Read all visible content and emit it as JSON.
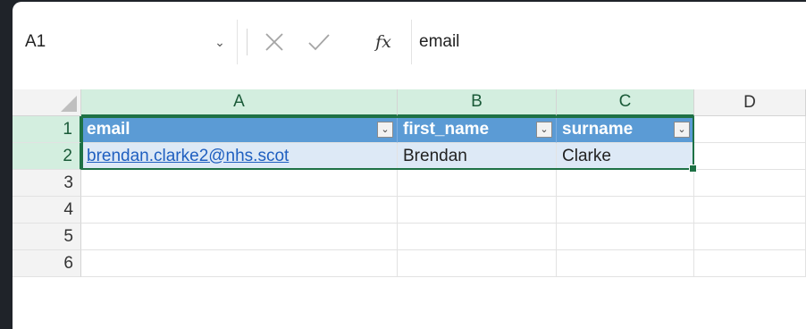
{
  "formula_bar": {
    "name_box": "A1",
    "cancel_icon": "close-icon",
    "enter_icon": "check-icon",
    "fx_label": "fx",
    "formula": "email"
  },
  "grid": {
    "columns": [
      "A",
      "B",
      "C",
      "D"
    ],
    "rows": [
      "1",
      "2",
      "3",
      "4",
      "5",
      "6"
    ],
    "table": {
      "headers": [
        "email",
        "first_name",
        "surname"
      ],
      "rows": [
        [
          "brendan.clarke2@nhs.scot",
          "Brendan",
          "Clarke"
        ]
      ]
    }
  },
  "colors": {
    "table_header": "#5b9bd5",
    "table_band": "#dde9f6",
    "selection": "#1e7145",
    "link": "#1f5fc0"
  }
}
